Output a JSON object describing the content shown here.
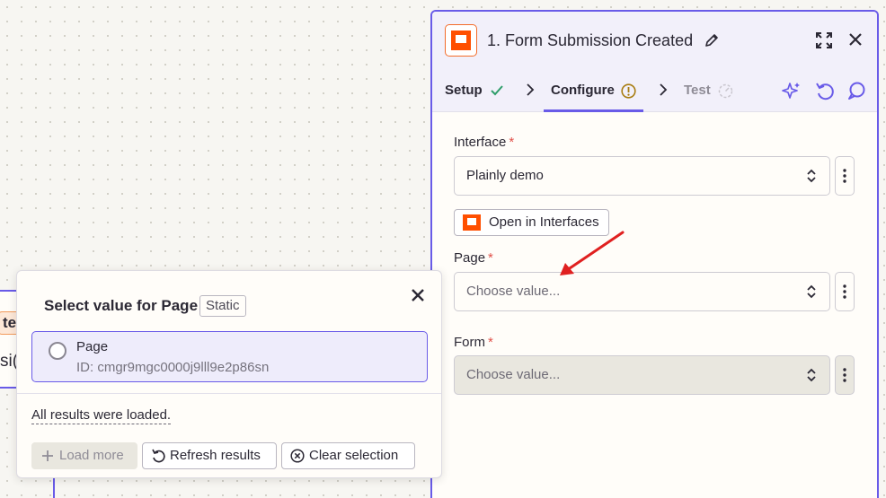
{
  "canvas": {
    "node_tag_fragment": "te",
    "node_sub_fragment": "si("
  },
  "panel": {
    "title": "1. Form Submission Created",
    "tabs": [
      {
        "label": "Setup",
        "status": "complete"
      },
      {
        "label": "Configure",
        "status": "warning"
      },
      {
        "label": "Test",
        "status": "pending"
      }
    ],
    "fields": {
      "interface": {
        "label": "Interface",
        "required_mark": "*",
        "value": "Plainly demo"
      },
      "open_button": "Open in Interfaces",
      "page": {
        "label": "Page",
        "required_mark": "*",
        "placeholder": "Choose value..."
      },
      "form": {
        "label": "Form",
        "required_mark": "*",
        "placeholder": "Choose value..."
      }
    }
  },
  "popover": {
    "title": "Select value for Page",
    "badge": "Static",
    "options": [
      {
        "label": "Page",
        "id_text": "ID: cmgr9mgc0000j9lll9e2p86sn",
        "selected": false
      }
    ],
    "status_text": "All results were loaded.",
    "buttons": {
      "load_more": "Load more",
      "refresh": "Refresh results",
      "clear": "Clear selection"
    }
  },
  "colors": {
    "accent": "#695be8",
    "brand": "#ff4f00",
    "required": "#e1514a",
    "annotation_arrow": "#e02020"
  }
}
